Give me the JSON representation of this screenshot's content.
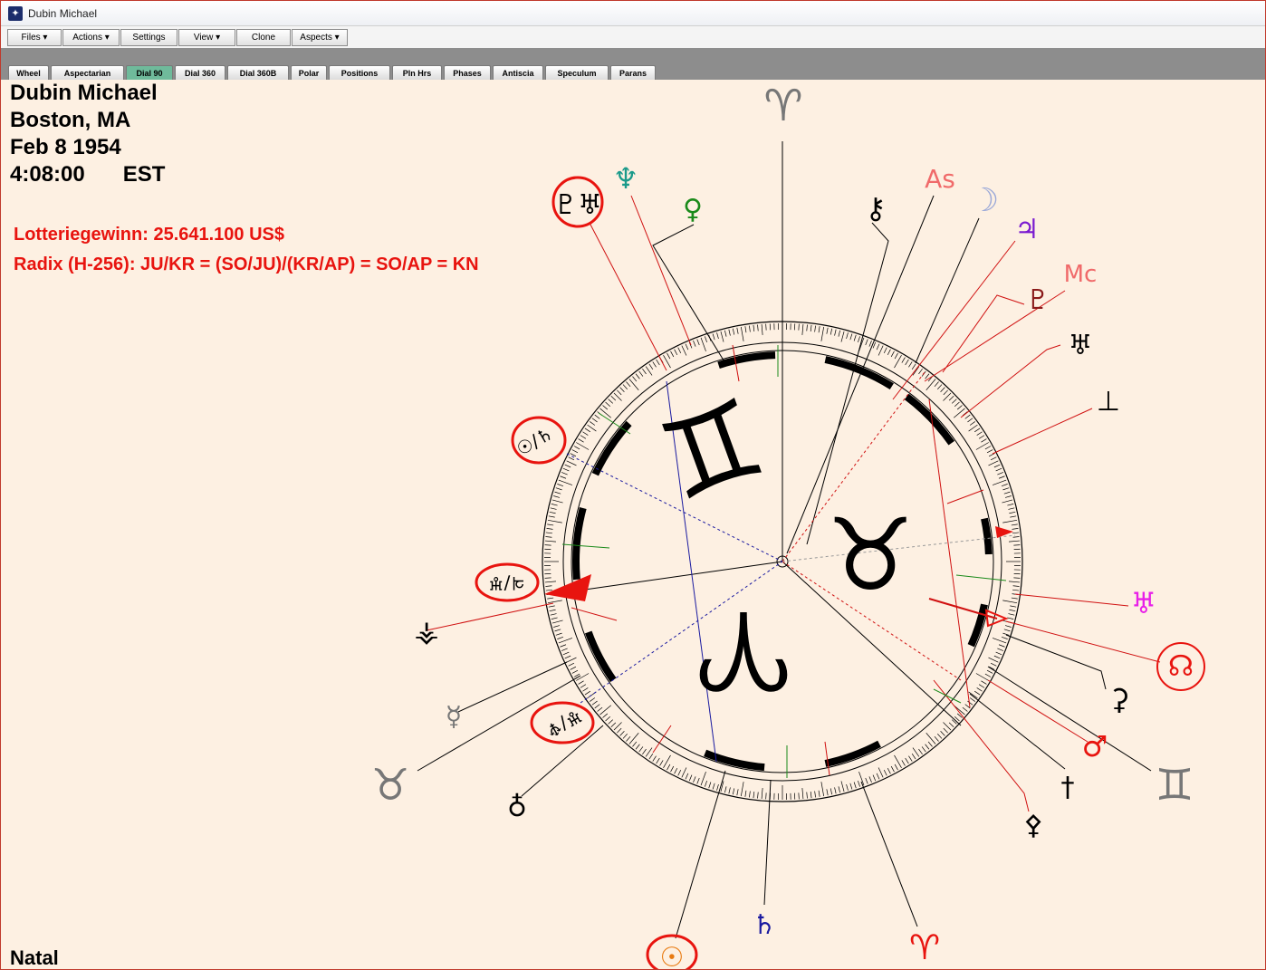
{
  "window": {
    "title": "Dubin Michael",
    "app_icon": "star-icon"
  },
  "menu": {
    "files": "Files",
    "actions": "Actions",
    "settings": "Settings",
    "view": "View",
    "clone": "Clone",
    "aspects": "Aspects"
  },
  "tabs": [
    {
      "label": "Wheel"
    },
    {
      "label": "Aspectarian"
    },
    {
      "label": "Dial 90",
      "active": true
    },
    {
      "label": "Dial 360"
    },
    {
      "label": "Dial 360B"
    },
    {
      "label": "Polar"
    },
    {
      "label": "Positions"
    },
    {
      "label": "Pln Hrs"
    },
    {
      "label": "Phases"
    },
    {
      "label": "Antiscia"
    },
    {
      "label": "Speculum"
    },
    {
      "label": "Parans"
    }
  ],
  "chart_info": {
    "name": "Dubin Michael",
    "place": "Boston, MA",
    "date": "Feb 8 1954",
    "time": "4:08:00",
    "zone": "EST"
  },
  "annotation": {
    "line1": "Lotteriegewinn: 25.641.100 US$",
    "line2": "Radix (H-256): JU/KR = (SO/JU)/(KR/AP) = SO/AP = KN"
  },
  "footer_label": "Natal",
  "colors": {
    "background": "#fdf0e2",
    "annotation_red": "#e8140f",
    "active_tab": "#6fba9b"
  },
  "dial": {
    "center_signs": [
      "♊",
      "♉",
      "♈"
    ],
    "outer_signs": [
      "♈",
      "♉",
      "♊",
      "♈"
    ],
    "planets": {
      "pluto_pair": "♇♅",
      "neptune": "♆",
      "venus": "♀",
      "chiron": "⚷",
      "asc": "As",
      "moon": "☽",
      "jupiter": "♃",
      "mc": "Mc",
      "uranus": "♅",
      "kronos": "⊥",
      "sun_saturn": "☉/♄",
      "jupiter_kronos": "♃/♅",
      "vulkanus": "⚴",
      "node": "☊",
      "ceres": "⚳",
      "mars": "♂",
      "mercury": "☿",
      "apollon_ad": "♅/♆",
      "hades": "♁",
      "saturn": "♄",
      "sun": "☉"
    }
  }
}
